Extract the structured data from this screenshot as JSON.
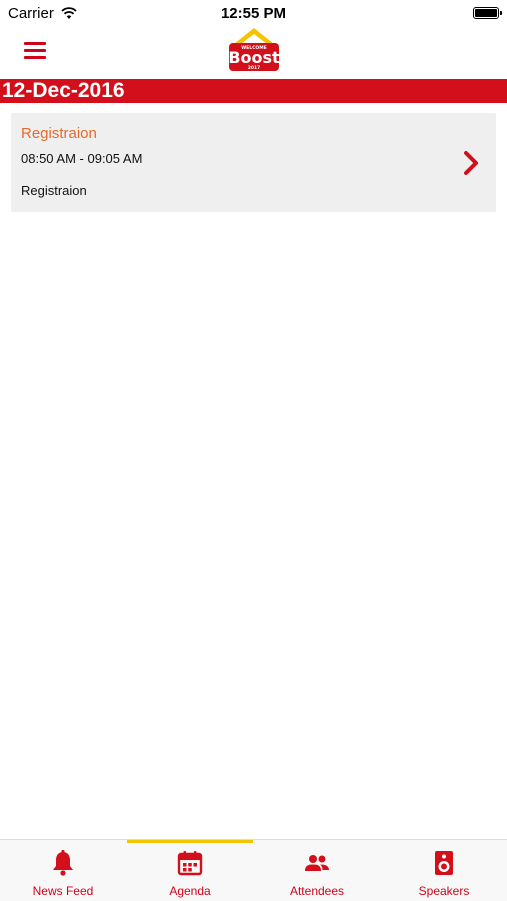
{
  "status_bar": {
    "carrier": "Carrier",
    "time": "12:55 PM"
  },
  "header": {
    "logo_top": "WELCOME",
    "logo_main": "Boost",
    "logo_year": "2017"
  },
  "agenda": {
    "date": "12-Dec-2016",
    "sessions": [
      {
        "title": "Registraion",
        "time": "08:50 AM - 09:05 AM",
        "description": "Registraion"
      }
    ]
  },
  "tabbar": {
    "selected": "Agenda",
    "tabs": [
      {
        "label": "News Feed",
        "icon": "bell-icon"
      },
      {
        "label": "Agenda",
        "icon": "calendar-icon"
      },
      {
        "label": "Attendees",
        "icon": "people-icon"
      },
      {
        "label": "Speakers",
        "icon": "speaker-icon"
      }
    ]
  },
  "colors": {
    "brand_red": "#d30f1b",
    "title_orange": "#e8682c",
    "tab_indicator": "#f5c400",
    "card_bg": "#efefef"
  }
}
